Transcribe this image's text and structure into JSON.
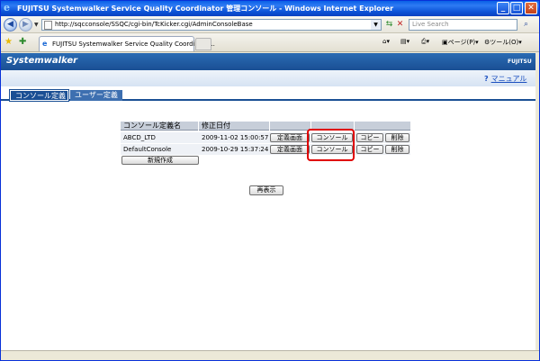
{
  "window": {
    "title": "FUJITSU Systemwalker Service Quality Coordinator 管理コンソール - Windows Internet Explorer",
    "icon": "ie-icon",
    "controls": {
      "minimize": "_",
      "maximize": "□",
      "close": "✕"
    }
  },
  "addressbar": {
    "url": "http://sqcconsole/SSQC/cgi-bin/TcKicker.cgi/AdminConsoleBase",
    "search_placeholder": "Live Search"
  },
  "tabs": [
    {
      "label": "FUJITSU Systemwalker Service Quality Coordinato..."
    }
  ],
  "commandbar": {
    "page_menu": "ページ(P)",
    "tools_menu": "ツール(O)"
  },
  "app": {
    "logo": "Systemwalker",
    "brand": "FUJITSU",
    "help_link": "マニュアル",
    "accent_color": "#1a4f94",
    "nav_tabs": [
      "コンソール定義",
      "ユーザー定義"
    ]
  },
  "console_table": {
    "headers": [
      "コンソール定義名",
      "修正日付"
    ],
    "rows": [
      {
        "name": "ABCD_LTD",
        "modified": "2009-11-02 15:00:57",
        "actions": [
          "定義画面",
          "コンソール",
          "コピー",
          "削除"
        ]
      },
      {
        "name": "DefaultConsole",
        "modified": "2009-10-29 15:37:24",
        "actions": [
          "定義画面",
          "コンソール",
          "コピー",
          "削除"
        ]
      }
    ],
    "new_button": "新規作成",
    "refresh_button": "再表示",
    "highlight_color": "#e00000"
  }
}
